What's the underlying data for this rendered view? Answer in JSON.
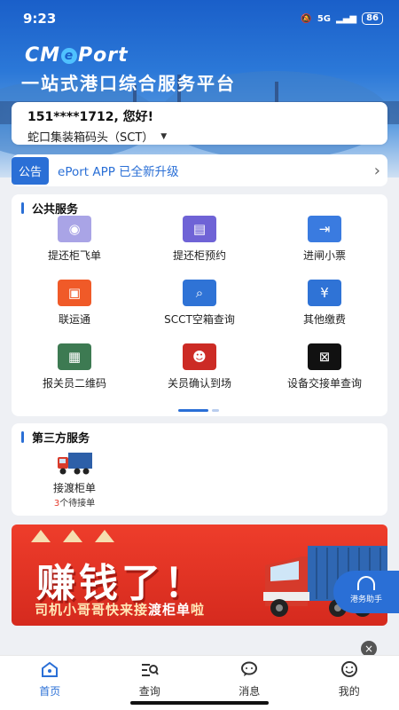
{
  "status": {
    "time": "9:23",
    "network": "5G",
    "battery": "86"
  },
  "brand": {
    "logo_pre": "CM",
    "logo_e": "e",
    "logo_post": "Port",
    "slogan": "一站式港口综合服务平台"
  },
  "user": {
    "greeting": "151****1712, 您好!",
    "terminal": "蛇口集装箱码头（SCT）"
  },
  "notice": {
    "tag": "公告",
    "text": "ePort APP 已全新升级"
  },
  "public_services": {
    "title": "公共服务",
    "items": [
      {
        "label": "提还柜飞单",
        "icon": "camera-icon",
        "color": "#a9a4e6"
      },
      {
        "label": "提还柜预约",
        "icon": "container-booking-icon",
        "color": "#6f63d6"
      },
      {
        "label": "进闸小票",
        "icon": "gate-entry-icon",
        "color": "#3a7be0"
      },
      {
        "label": "联运通",
        "icon": "multimodal-icon",
        "color": "#f05a28"
      },
      {
        "label": "SCCT空箱查询",
        "icon": "empty-container-search-icon",
        "color": "#2f73d6"
      },
      {
        "label": "其他缴费",
        "icon": "payment-icon",
        "color": "#2f73d6"
      },
      {
        "label": "报关员二维码",
        "icon": "qrcode-icon",
        "color": "#3d7a52"
      },
      {
        "label": "关员确认到场",
        "icon": "officer-confirm-icon",
        "color": "#cc2b25"
      },
      {
        "label": "设备交接单查询",
        "icon": "equipment-receipt-icon",
        "color": "#111111"
      }
    ]
  },
  "third_services": {
    "title": "第三方服务",
    "items": [
      {
        "label": "接渡柜单",
        "pending_count": "3",
        "pending_suffix": "个待接单",
        "icon": "truck-icon"
      }
    ]
  },
  "banner": {
    "title": "赚钱了！",
    "tagline_pre": "司机小哥哥快来接",
    "tagline_highlight": "渡柜单",
    "tagline_post": "啦"
  },
  "assistant": {
    "label": "港务助手"
  },
  "close_symbol": "×",
  "tabs": [
    {
      "label": "首页",
      "icon": "home-icon",
      "active": true
    },
    {
      "label": "查询",
      "icon": "search-list-icon",
      "active": false
    },
    {
      "label": "消息",
      "icon": "message-icon",
      "active": false
    },
    {
      "label": "我的",
      "icon": "profile-icon",
      "active": false
    }
  ],
  "colors": {
    "accent": "#2a6fd6",
    "banner_red": "#e8382a",
    "highlight_red": "#e53b2b"
  }
}
